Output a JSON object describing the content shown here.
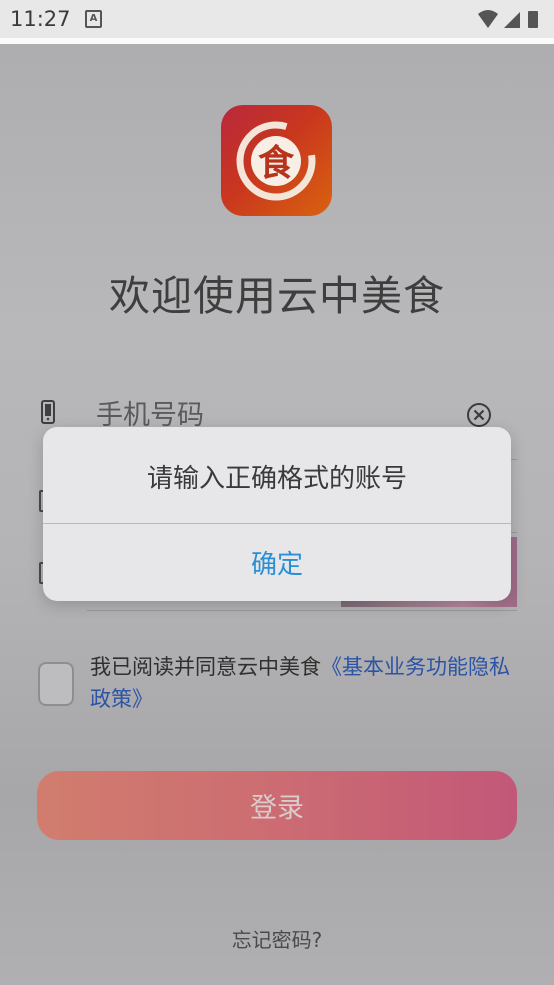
{
  "status_bar": {
    "time": "11:27",
    "notification_icon": "a-icon",
    "signal_icons": [
      "wifi-icon",
      "signal-icon",
      "battery-icon"
    ]
  },
  "app": {
    "logo_icon": "food-logo-icon",
    "logo_char": "食",
    "title": "欢迎使用云中美食"
  },
  "login": {
    "phone_placeholder": "手机号码",
    "agree_text": "我已阅读并同意云中美食",
    "agree_link": "《基本业务功能隐私政策》",
    "login_label": "登录",
    "forgot_label": "忘记密码?"
  },
  "dialog": {
    "message": "请输入正确格式的账号",
    "ok_label": "确定"
  },
  "colors": {
    "accent": "#2a8fd6",
    "link": "#2c54a6",
    "login_gradient_start": "#d17d6e",
    "login_gradient_end": "#c25878",
    "logo_gradient_start": "#b9283d",
    "logo_gradient_end": "#d9630f"
  }
}
